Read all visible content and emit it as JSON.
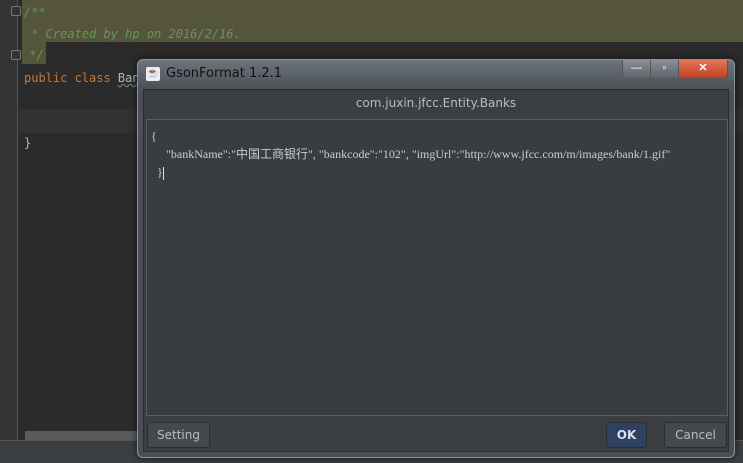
{
  "editor": {
    "lines": [
      "/**",
      " * Created by hp on 2016/2/16.",
      " */"
    ],
    "class_kw": "public class ",
    "class_name": "Ban",
    "close_brace": "}"
  },
  "dialog": {
    "title": "GsonFormat 1.2.1",
    "window_buttons": {
      "minimize": "—",
      "maximize": "▫",
      "close": "✕"
    },
    "class_path": "com.juxin.jfcc.Entity.Banks",
    "json_lines": [
      "{",
      "     \"bankName\":\"中国工商银行\", \"bankcode\":\"102\", \"imgUrl\":\"http://www.jfcc.com/m/images/bank/1.gif\"",
      "  }"
    ],
    "setting_label": "Setting",
    "ok_label": "OK",
    "cancel_label": "Cancel"
  }
}
